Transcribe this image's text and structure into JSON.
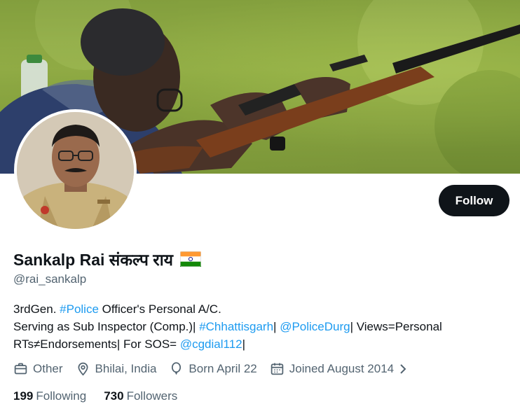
{
  "profile": {
    "display_name": "Sankalp Rai संकल्प राय",
    "handle": "@rai_sankalp",
    "follow_label": "Follow",
    "flag_icon": "india-flag-icon"
  },
  "bio": {
    "line1_prefix": "3rdGen. ",
    "line1_tag": "#Police",
    "line1_suffix": " Officer's Personal A/C.",
    "line2_prefix": "Serving as Sub Inspector (Comp.)| ",
    "line2_tag": "#Chhattisgarh",
    "line2_mid": "| ",
    "line2_mention": "@PoliceDurg",
    "line2_suffix": "| Views=Personal",
    "line3_prefix": "RTs≠Endorsements| For SOS= ",
    "line3_mention": "@cgdial112",
    "line3_suffix": "|"
  },
  "meta": {
    "category": "Other",
    "location": "Bhilai, India",
    "birthday": "Born April 22",
    "joined": "Joined August 2014"
  },
  "stats": {
    "following_count": "199",
    "following_label": "Following",
    "followers_count": "730",
    "followers_label": "Followers"
  },
  "colors": {
    "accent": "#1d9bf0",
    "text": "#0f1419",
    "muted": "#536471",
    "button": "#0f1419"
  }
}
